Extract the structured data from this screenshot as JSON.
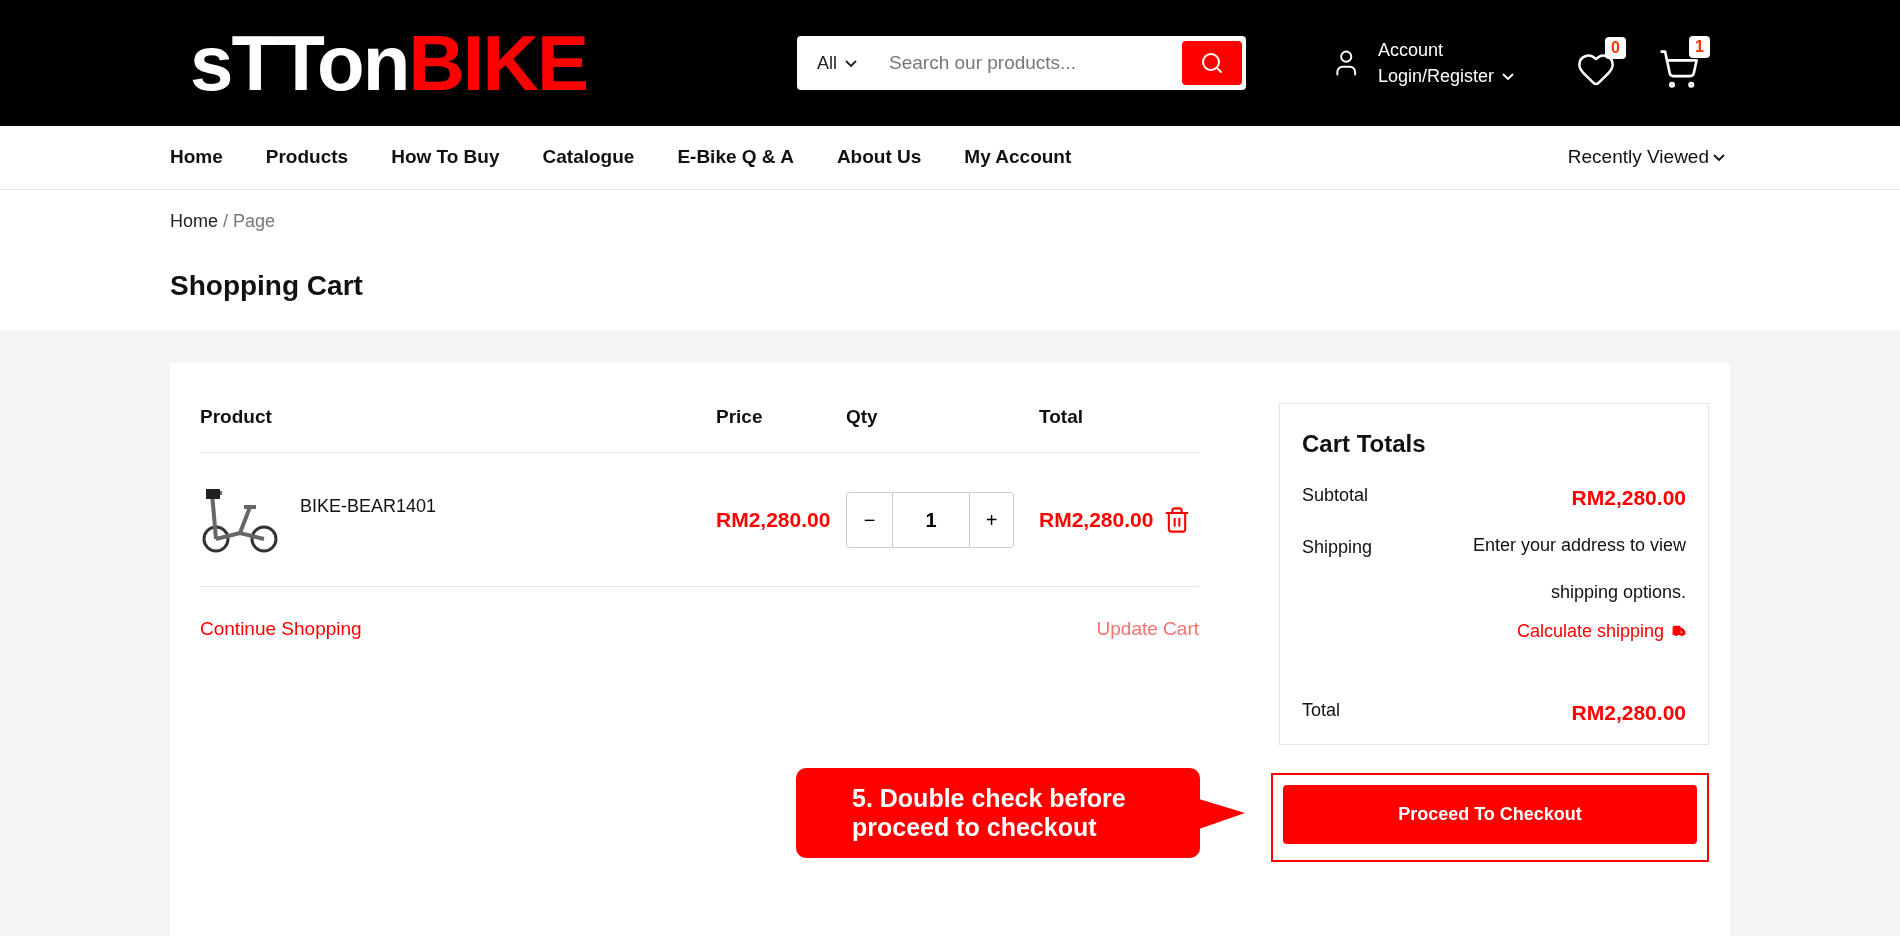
{
  "header": {
    "logo": {
      "first": "sTTon",
      "second": "BIKE"
    },
    "search": {
      "category": "All",
      "placeholder": "Search our products..."
    },
    "account": {
      "label": "Account",
      "link": "Login/Register"
    },
    "wishlist_count": "0",
    "cart_count": "1"
  },
  "nav": {
    "items": [
      "Home",
      "Products",
      "How To Buy",
      "Catalogue",
      "E-Bike Q & A",
      "About Us",
      "My Account"
    ],
    "recent": "Recently Viewed"
  },
  "breadcrumb": {
    "home": "Home",
    "current": "/ Page"
  },
  "page_title": "Shopping Cart",
  "cart": {
    "columns": [
      "Product",
      "Price",
      "Qty",
      "Total"
    ],
    "rows": [
      {
        "name": "BIKE-BEAR1401",
        "price": "RM2,280.00",
        "qty": "1",
        "minus": "−",
        "plus": "+",
        "total": "RM2,280.00"
      }
    ],
    "continue": "Continue Shopping",
    "update": "Update Cart"
  },
  "totals": {
    "title": "Cart Totals",
    "subtotal_label": "Subtotal",
    "subtotal": "RM2,280.00",
    "shipping_label": "Shipping",
    "shipping_note": "Enter your address to view shipping options.",
    "calculate": "Calculate shipping",
    "total_label": "Total",
    "total": "RM2,280.00",
    "checkout": "Proceed To Checkout"
  },
  "callout": "5. Double check before proceed to checkout"
}
